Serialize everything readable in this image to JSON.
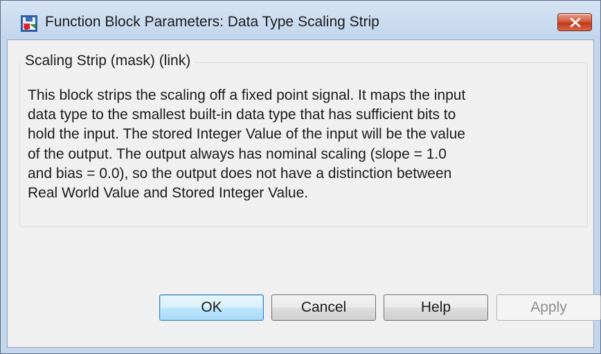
{
  "window": {
    "title": "Function Block Parameters: Data Type Scaling Strip",
    "app_icon": "simulink-block-icon",
    "close_icon": "close-icon"
  },
  "group": {
    "title": "Scaling Strip (mask) (link)",
    "description_lines": [
      "This block strips the scaling off a fixed point signal.  It maps the input",
      "data type to the smallest built-in data type that has sufficient bits to",
      "hold the input.  The stored Integer Value of the input will be the value",
      "of the output.  The output always has nominal scaling (slope = 1.0",
      "and bias = 0.0), so the output does not have a distinction between",
      "Real World Value and Stored Integer Value."
    ]
  },
  "buttons": {
    "ok": "OK",
    "cancel": "Cancel",
    "help": "Help",
    "apply": "Apply"
  },
  "colors": {
    "titlebar": "#c4d6ec",
    "client_background": "#f0f0f0",
    "close_button": "#c2391a",
    "default_button_border": "#3c7fb1"
  }
}
